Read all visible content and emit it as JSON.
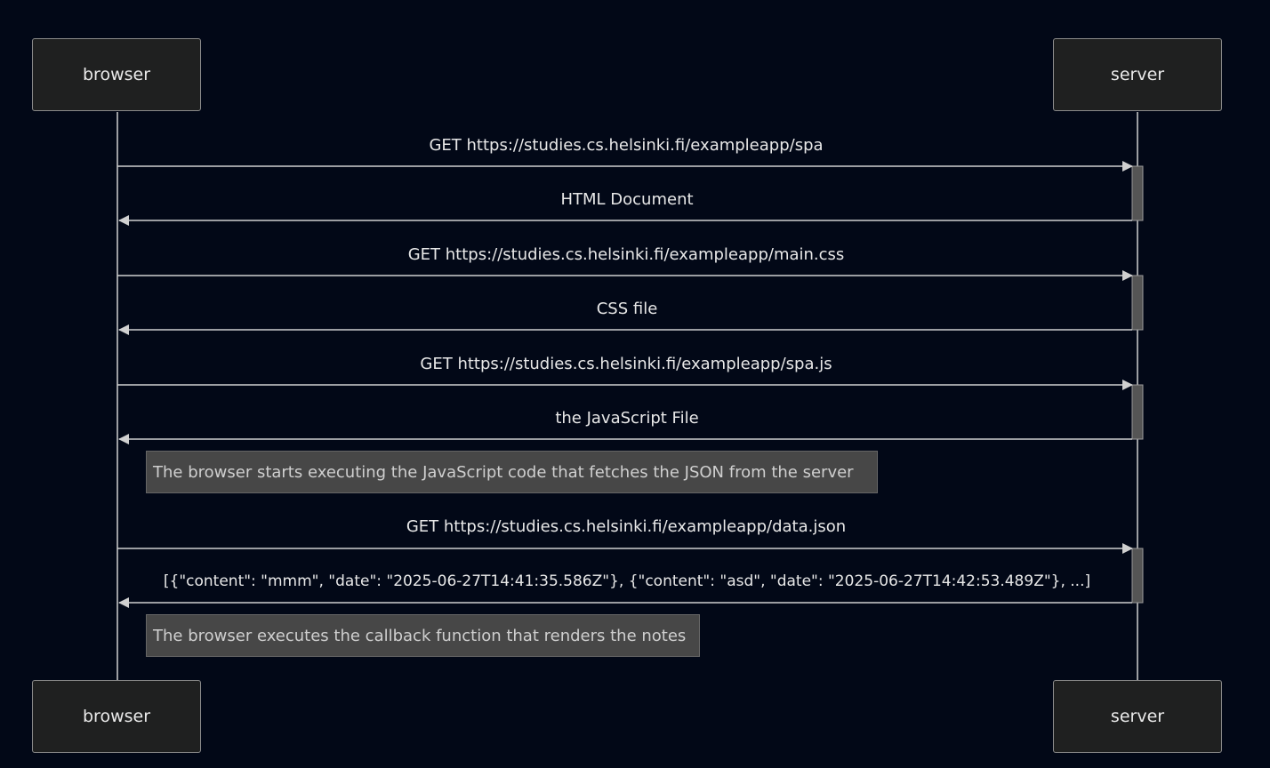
{
  "participants": {
    "browser": "browser",
    "server": "server"
  },
  "messages": [
    {
      "from": "browser",
      "to": "server",
      "label": "GET https://studies.cs.helsinki.fi/exampleapp/spa"
    },
    {
      "from": "server",
      "to": "browser",
      "label": "HTML Document"
    },
    {
      "from": "browser",
      "to": "server",
      "label": "GET https://studies.cs.helsinki.fi/exampleapp/main.css"
    },
    {
      "from": "server",
      "to": "browser",
      "label": "CSS file"
    },
    {
      "from": "browser",
      "to": "server",
      "label": "GET https://studies.cs.helsinki.fi/exampleapp/spa.js"
    },
    {
      "from": "server",
      "to": "browser",
      "label": "the JavaScript File"
    },
    {
      "from": "browser",
      "to": "server",
      "label": "GET https://studies.cs.helsinki.fi/exampleapp/data.json"
    },
    {
      "from": "server",
      "to": "browser",
      "label": "[{\"content\": \"mmm\", \"date\": \"2025-06-27T14:41:35.586Z\"}, {\"content\": \"asd\", \"date\": \"2025-06-27T14:42:53.489Z\"}, ...]"
    }
  ],
  "notes": [
    {
      "text": "The browser starts executing the JavaScript code that fetches the JSON from the server"
    },
    {
      "text": "The browser executes the callback function that renders the notes"
    }
  ],
  "colors": {
    "background": "#020817",
    "actor_fill": "#1f2020",
    "line": "#d0d0d0",
    "activation": "#555555",
    "note_fill": "#474747"
  }
}
